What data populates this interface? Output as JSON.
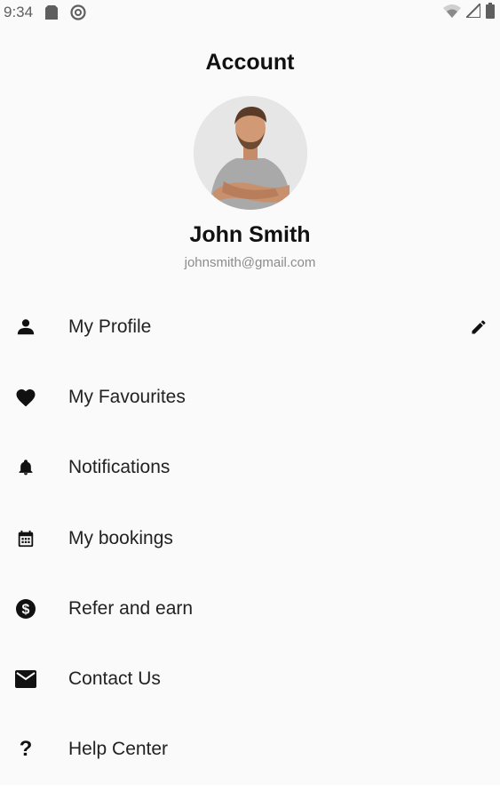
{
  "status_bar": {
    "time": "9:34",
    "left_icons": [
      "sd-card-icon",
      "at-sign-icon"
    ],
    "right_icons": [
      "wifi-icon",
      "signal-icon",
      "battery-icon"
    ]
  },
  "header": {
    "title": "Account"
  },
  "profile": {
    "avatar": "avatar-photo",
    "name": "John Smith",
    "email": "johnsmith@gmail.com"
  },
  "menu": {
    "items": [
      {
        "label": "My Profile",
        "icon": "person-icon",
        "trailing_icon": "pencil-icon"
      },
      {
        "label": "My Favourites",
        "icon": "heart-icon"
      },
      {
        "label": "Notifications",
        "icon": "bell-icon"
      },
      {
        "label": "My bookings",
        "icon": "calendar-icon"
      },
      {
        "label": "Refer and earn",
        "icon": "dollar-circle-icon"
      },
      {
        "label": "Contact Us",
        "icon": "mail-icon"
      },
      {
        "label": "Help Center",
        "icon": "question-icon",
        "glyph": "?"
      }
    ]
  },
  "colors": {
    "background": "#fafafa",
    "text": "#1f1f1f",
    "muted": "#8c8c8c",
    "status": "#5f5f5f"
  }
}
